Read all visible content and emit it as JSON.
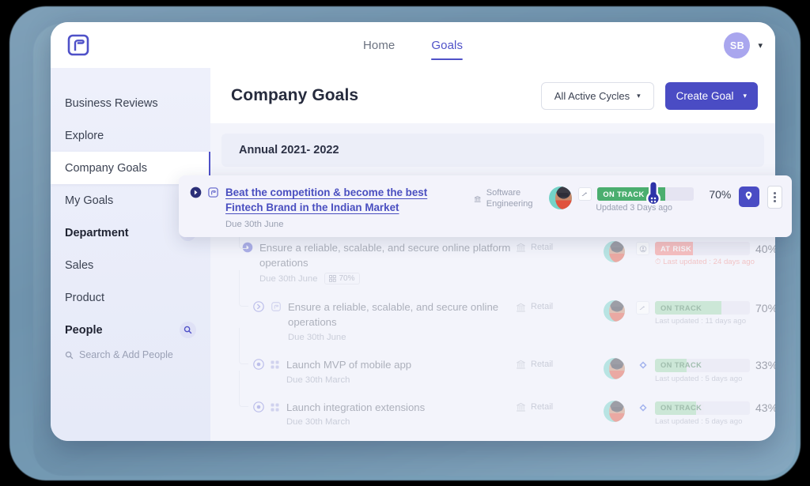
{
  "brand": {
    "logo_icon": "profit-logo-icon",
    "accent": "#4f51c8"
  },
  "topbar": {
    "tabs": [
      {
        "label": "Home",
        "active": false
      },
      {
        "label": "Goals",
        "active": true
      }
    ],
    "user": {
      "initials": "SB",
      "caret_icon": "chevron-down-icon"
    }
  },
  "sidebar": {
    "items": [
      {
        "label": "Business Reviews",
        "type": "link"
      },
      {
        "label": "Explore",
        "type": "link"
      },
      {
        "label": "Company Goals",
        "type": "link",
        "selected": true
      },
      {
        "label": "My Goals",
        "type": "link"
      },
      {
        "label": "Department",
        "type": "group",
        "search_icon": "search-icon"
      },
      {
        "label": "Sales",
        "type": "link"
      },
      {
        "label": "Product",
        "type": "link"
      },
      {
        "label": "People",
        "type": "group",
        "search_icon": "search-icon"
      }
    ],
    "people_hint": "Search & Add People",
    "people_hint_icon": "search-icon"
  },
  "main": {
    "page_title": "Company Goals",
    "cycles_filter": {
      "label": "All Active Cycles",
      "icon": "chevron-down-icon"
    },
    "create_goal": {
      "label": "Create Goal",
      "icon": "chevron-down-icon"
    },
    "cycle_band": "Annual 2021- 2022"
  },
  "goals": [
    {
      "id": "g1",
      "highlighted": true,
      "expand_icon": "chevron-right-circle-icon",
      "type_icon": "objective-icon",
      "title": "Beat the competition & become the best Fintech Brand in the Indian Market",
      "due": "Due 30th June",
      "weight": null,
      "team": "Software Engineering",
      "team_icon": "bank-icon",
      "owner_avatar": "owner-avatar",
      "status_icon": "trend-icon",
      "status": "ON TRACK",
      "status_color": "#4bae6f",
      "progress": 70,
      "percent_label": "70%",
      "updated": "Updated 3 Days ago",
      "pin_icon": "pin-icon",
      "more_icon": "more-vertical-icon",
      "thermometer_icon": "thermometer-icon"
    },
    {
      "id": "g2",
      "indent": 0,
      "expand_icon": "chevron-right-circle-icon",
      "title": "Ensure a reliable, scalable, and secure online platform operations",
      "due": "Due 30th June",
      "weight": "70%",
      "weight_icon": "weight-icon",
      "team": "Retail",
      "team_icon": "bank-icon",
      "owner_avatar": "owner-avatar",
      "status_icon": "user-circle-icon",
      "status": "AT RISK",
      "status_color": "#f8827c",
      "progress": 40,
      "percent_label": "40%",
      "updated": "Last updated : 24 days ago",
      "updated_icon": "clock-icon",
      "at_risk": true
    },
    {
      "id": "g3",
      "indent": 1,
      "expand_icon": "chevron-right-circle-icon",
      "type_icon": "objective-icon",
      "title": "Ensure a reliable, scalable, and secure online operations",
      "due": "Due 30th June",
      "team": "Retail",
      "team_icon": "bank-icon",
      "owner_avatar": "owner-avatar",
      "status_icon": "trend-icon",
      "status": "ON TRACK",
      "status_color": "#9fd9ae",
      "progress": 70,
      "percent_label": "70%",
      "updated": "Last updated : 11 days ago"
    },
    {
      "id": "g4",
      "indent": 1,
      "expand_icon": "target-icon",
      "type_icon": "grid-icon",
      "title": "Launch MVP of mobile app",
      "due": "Due 30th March",
      "team": "Retail",
      "team_icon": "bank-icon",
      "owner_avatar": "owner-avatar",
      "status_icon": "diamond-icon",
      "status": "ON TRACK",
      "status_color": "#9fd9ae",
      "progress": 33,
      "percent_label": "33%",
      "updated": "Last updated : 5 days ago"
    },
    {
      "id": "g5",
      "indent": 1,
      "expand_icon": "target-icon",
      "type_icon": "grid-icon",
      "title": "Launch integration extensions",
      "due": "Due 30th March",
      "team": "Retail",
      "team_icon": "bank-icon",
      "owner_avatar": "owner-avatar",
      "status_icon": "diamond-icon",
      "status": "ON TRACK",
      "status_color": "#9fd9ae",
      "progress": 43,
      "percent_label": "43%",
      "updated": "Last updated : 5 days ago"
    }
  ]
}
